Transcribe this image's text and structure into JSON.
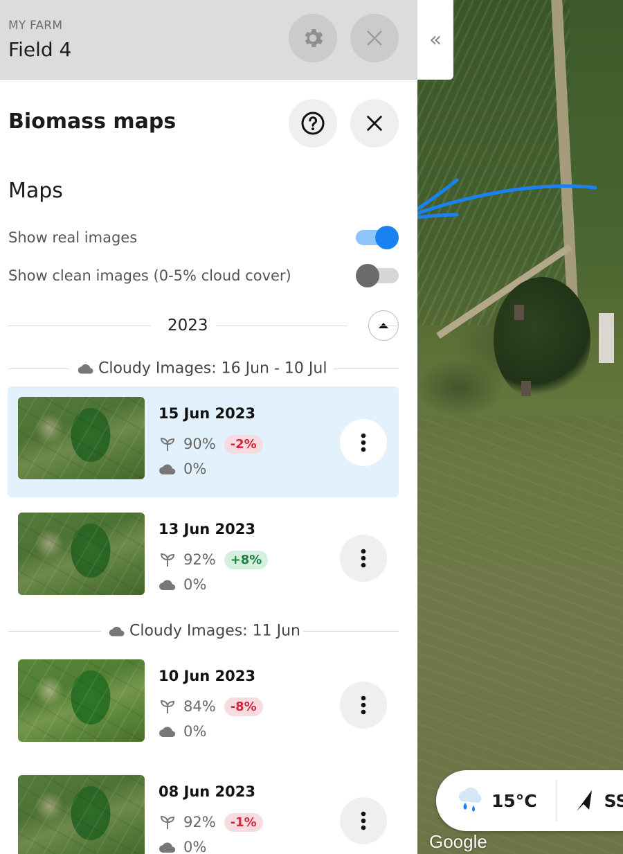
{
  "header": {
    "farm_label": "MY FARM",
    "field_name": "Field 4"
  },
  "panel": {
    "title": "Biomass maps",
    "maps_heading": "Maps"
  },
  "toggles": [
    {
      "label": "Show real images",
      "on": true
    },
    {
      "label": "Show clean images (0-5% cloud cover)",
      "on": false
    }
  ],
  "year_group": {
    "label": "2023",
    "expanded": true
  },
  "cloudy_groups": [
    {
      "label": "Cloudy Images: 16 Jun - 10 Jul"
    },
    {
      "label": "Cloudy Images: 11 Jun"
    }
  ],
  "images": [
    {
      "date": "15 Jun 2023",
      "biomass": "90%",
      "change": "-2%",
      "change_dir": "negative",
      "cloud": "0%",
      "selected": true
    },
    {
      "date": "13 Jun 2023",
      "biomass": "92%",
      "change": "+8%",
      "change_dir": "positive",
      "cloud": "0%",
      "selected": false
    },
    {
      "date": "10 Jun 2023",
      "biomass": "84%",
      "change": "-8%",
      "change_dir": "negative",
      "cloud": "0%",
      "selected": false
    },
    {
      "date": "08 Jun 2023",
      "biomass": "92%",
      "change": "-1%",
      "change_dir": "negative",
      "cloud": "0%",
      "selected": false
    }
  ],
  "map": {
    "weather": {
      "temperature": "15°C",
      "wind_direction": "SSV"
    },
    "attribution": "Google"
  },
  "icons": {
    "settings": "gear-icon",
    "close": "close-icon",
    "help": "help-circle-icon",
    "collapse": "double-chevron-left-icon",
    "biomass": "sprout-icon",
    "cloud": "cloud-icon",
    "more": "kebab-menu-icon",
    "expand": "chevron-up-icon",
    "rain": "rain-cloud-icon",
    "wind": "navigation-arrow-icon"
  },
  "colors": {
    "accent": "#1a82f0",
    "selected_bg": "#e3f1fd",
    "negative": "#d0283a",
    "positive": "#1e7f3f"
  }
}
